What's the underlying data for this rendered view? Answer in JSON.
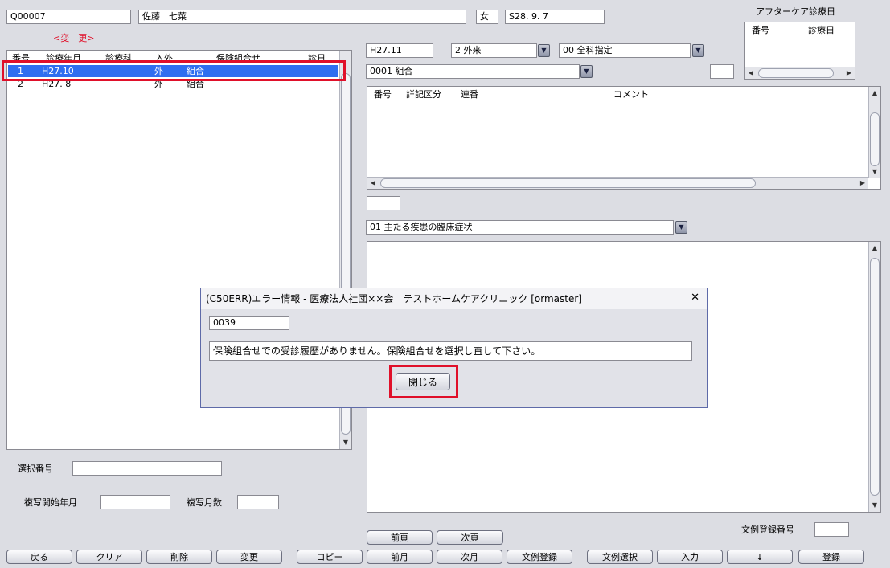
{
  "patient": {
    "id": "Q00007",
    "name": "佐藤　七菜",
    "sex": "女",
    "birth": "S28. 9. 7"
  },
  "status_label": "<変　更>",
  "list": {
    "headers": [
      "番号",
      "診療年月",
      "診療科",
      "入外",
      "保険組合せ",
      "診日"
    ],
    "rows": [
      {
        "no": "1",
        "ym": "H27.10",
        "io": "外",
        "ins": "組合"
      },
      {
        "no": "2",
        "ym": "H27. 8",
        "io": "外",
        "ins": "組合"
      }
    ]
  },
  "aftercare": {
    "title": "アフターケア診療日",
    "col_no": "番号",
    "col_date": "診療日"
  },
  "right": {
    "ym": "H27.11",
    "inout": "2 外来",
    "dept": "00 全科指定",
    "insurance": "0001 組合",
    "detail_headers": [
      "番号",
      "詳記区分",
      "連番",
      "コメント"
    ],
    "category": "01 主たる疾患の臨床症状"
  },
  "bottom": {
    "select_no_label": "選択番号",
    "copy_start_label": "複写開始年月",
    "copy_months_label": "複写月数",
    "template_no_label": "文例登録番号"
  },
  "buttons": {
    "prev_page": "前頁",
    "next_page": "次頁",
    "back": "戻る",
    "clear": "クリア",
    "delete": "削除",
    "change": "変更",
    "copy": "コピー",
    "prev_month": "前月",
    "next_month": "次月",
    "template_register": "文例登録",
    "template_select": "文例選択",
    "input": "入力",
    "down": "↓",
    "register": "登録"
  },
  "dialog": {
    "title": "(C50ERR)エラー情報 - 医療法人社団××会　テストホームケアクリニック [ormaster]",
    "code": "0039",
    "message": "保険組合せでの受診履歴がありません。保険組合せを選択し直して下さい。",
    "close_label": "閉じる",
    "close_glyph": "✕"
  },
  "colors": {
    "highlight": "#e0102a",
    "selection": "#2f6ef0",
    "background": "#dcdde3"
  }
}
